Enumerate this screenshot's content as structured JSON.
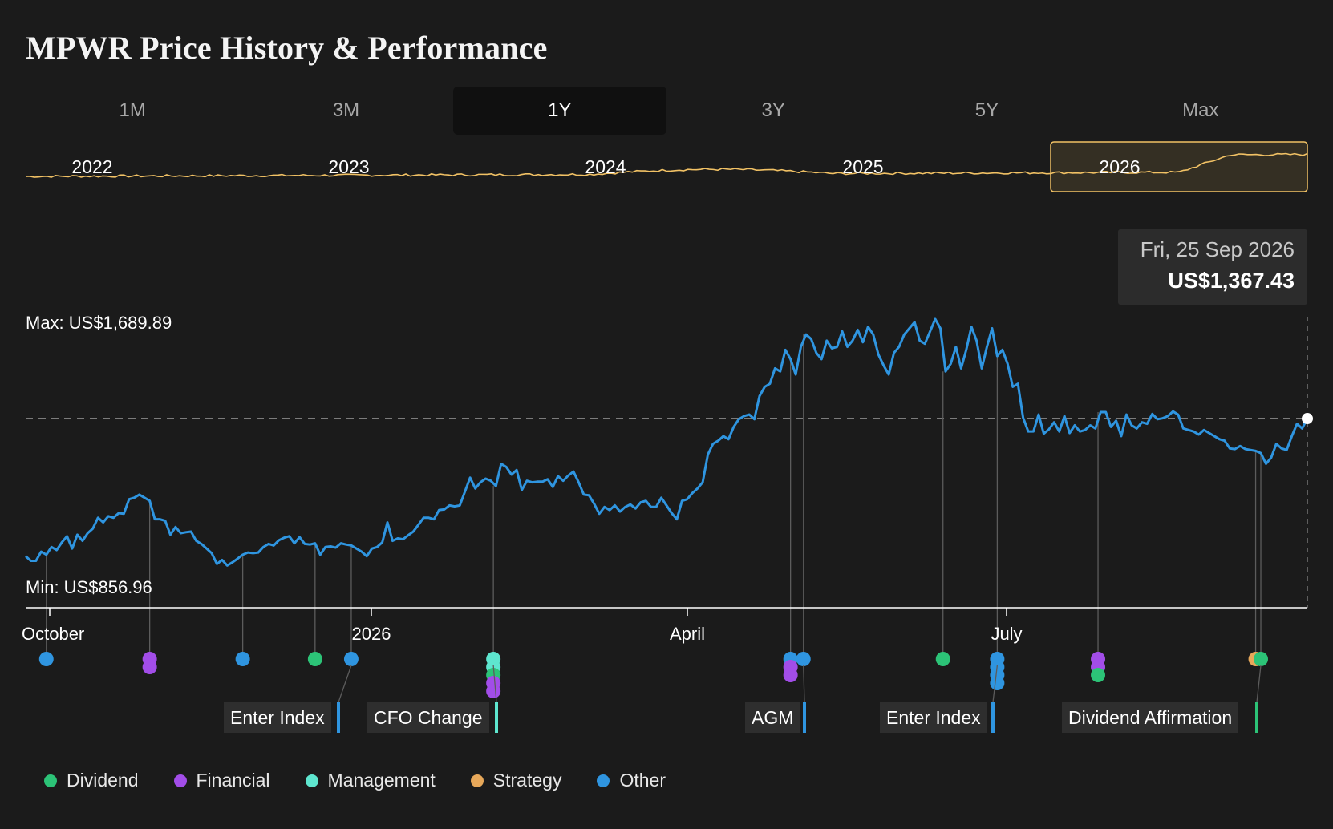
{
  "title": "MPWR Price History & Performance",
  "tabs": [
    "1M",
    "3M",
    "1Y",
    "3Y",
    "5Y",
    "Max"
  ],
  "active_tab": "1Y",
  "navigator": {
    "year_labels": [
      "2022",
      "2023",
      "2024",
      "2025",
      "2026"
    ],
    "color": "#f2c265"
  },
  "tooltip": {
    "date": "Fri, 25 Sep 2026",
    "price": "US$1,367.43"
  },
  "max_label": "Max: US$1,689.89",
  "min_label": "Min: US$856.96",
  "colors": {
    "line": "#2f95e0",
    "Dividend": "#2cc377",
    "Financial": "#a24de8",
    "Management": "#5ee6cf",
    "Strategy": "#e7a85a",
    "Other": "#2f95e0"
  },
  "legend": [
    {
      "name": "Dividend",
      "color": "#2cc377"
    },
    {
      "name": "Financial",
      "color": "#a24de8"
    },
    {
      "name": "Management",
      "color": "#5ee6cf"
    },
    {
      "name": "Strategy",
      "color": "#e7a85a"
    },
    {
      "name": "Other",
      "color": "#2f95e0"
    }
  ],
  "event_labels": [
    {
      "text": "Enter Index",
      "color": "#2f95e0"
    },
    {
      "text": "CFO Change",
      "color": "#5ee6cf"
    },
    {
      "text": "AGM",
      "color": "#2f95e0"
    },
    {
      "text": "Enter Index",
      "color": "#2f95e0"
    },
    {
      "text": "Dividend Affirmation",
      "color": "#2cc377"
    }
  ],
  "chart_data": {
    "type": "line",
    "title": "MPWR Price History & Performance",
    "x_tick_labels": [
      "October",
      "2026",
      "April",
      "July"
    ],
    "x_range": [
      "2025-09-25",
      "2026-09-25"
    ],
    "y_range": [
      856.96,
      1689.89
    ],
    "reference_value": 1367.43,
    "series": [
      {
        "values": [
          [
            0,
            920
          ],
          [
            2,
            905
          ],
          [
            4,
            905
          ],
          [
            6,
            935
          ],
          [
            8,
            925
          ],
          [
            10,
            950
          ],
          [
            12,
            940
          ],
          [
            14,
            965
          ],
          [
            16,
            985
          ],
          [
            18,
            945
          ],
          [
            20,
            990
          ],
          [
            22,
            970
          ],
          [
            24,
            995
          ],
          [
            26,
            1010
          ],
          [
            28,
            1045
          ],
          [
            30,
            1030
          ],
          [
            32,
            1050
          ],
          [
            34,
            1045
          ],
          [
            36,
            1060
          ],
          [
            38,
            1058
          ],
          [
            40,
            1105
          ],
          [
            42,
            1110
          ],
          [
            44,
            1120
          ],
          [
            46,
            1110
          ],
          [
            48,
            1100
          ],
          [
            50,
            1040
          ],
          [
            52,
            1040
          ],
          [
            54,
            1035
          ],
          [
            56,
            990
          ],
          [
            58,
            1015
          ],
          [
            60,
            995
          ],
          [
            62,
            998
          ],
          [
            64,
            1000
          ],
          [
            66,
            970
          ],
          [
            68,
            960
          ],
          [
            70,
            945
          ],
          [
            72,
            930
          ],
          [
            74,
            895
          ],
          [
            76,
            908
          ],
          [
            78,
            890
          ],
          [
            80,
            900
          ],
          [
            82,
            912
          ],
          [
            84,
            925
          ],
          [
            86,
            932
          ],
          [
            88,
            930
          ],
          [
            90,
            932
          ],
          [
            92,
            950
          ],
          [
            94,
            960
          ],
          [
            96,
            955
          ],
          [
            98,
            972
          ],
          [
            100,
            980
          ],
          [
            102,
            985
          ],
          [
            104,
            962
          ],
          [
            106,
            982
          ],
          [
            108,
            960
          ],
          [
            110,
            958
          ],
          [
            112,
            962
          ],
          [
            114,
            925
          ],
          [
            116,
            950
          ],
          [
            118,
            952
          ],
          [
            120,
            948
          ],
          [
            122,
            962
          ],
          [
            124,
            958
          ],
          [
            126,
            955
          ],
          [
            128,
            945
          ],
          [
            130,
            935
          ],
          [
            132,
            920
          ],
          [
            134,
            945
          ],
          [
            136,
            950
          ],
          [
            138,
            965
          ],
          [
            140,
            1030
          ],
          [
            142,
            970
          ],
          [
            144,
            978
          ],
          [
            146,
            975
          ],
          [
            148,
            988
          ],
          [
            150,
            1000
          ],
          [
            152,
            1022
          ],
          [
            154,
            1045
          ],
          [
            156,
            1045
          ],
          [
            158,
            1040
          ],
          [
            160,
            1070
          ],
          [
            162,
            1072
          ],
          [
            164,
            1085
          ],
          [
            166,
            1082
          ],
          [
            168,
            1085
          ],
          [
            170,
            1130
          ],
          [
            172,
            1175
          ],
          [
            174,
            1140
          ],
          [
            176,
            1160
          ],
          [
            178,
            1172
          ],
          [
            180,
            1165
          ],
          [
            182,
            1148
          ],
          [
            184,
            1220
          ],
          [
            186,
            1210
          ],
          [
            188,
            1185
          ],
          [
            190,
            1200
          ],
          [
            192,
            1135
          ],
          [
            194,
            1165
          ],
          [
            196,
            1160
          ],
          [
            198,
            1162
          ],
          [
            200,
            1162
          ],
          [
            202,
            1170
          ],
          [
            204,
            1145
          ],
          [
            206,
            1180
          ],
          [
            208,
            1165
          ],
          [
            210,
            1182
          ],
          [
            212,
            1195
          ],
          [
            214,
            1160
          ],
          [
            216,
            1120
          ],
          [
            218,
            1118
          ],
          [
            220,
            1090
          ],
          [
            222,
            1058
          ],
          [
            224,
            1080
          ],
          [
            226,
            1070
          ],
          [
            228,
            1085
          ],
          [
            230,
            1065
          ],
          [
            232,
            1080
          ],
          [
            234,
            1088
          ],
          [
            236,
            1075
          ],
          [
            238,
            1095
          ],
          [
            240,
            1100
          ],
          [
            242,
            1080
          ],
          [
            244,
            1080
          ],
          [
            246,
            1110
          ],
          [
            248,
            1085
          ],
          [
            250,
            1060
          ],
          [
            252,
            1040
          ],
          [
            254,
            1100
          ],
          [
            256,
            1105
          ],
          [
            258,
            1125
          ],
          [
            260,
            1140
          ],
          [
            262,
            1160
          ],
          [
            264,
            1250
          ],
          [
            266,
            1285
          ],
          [
            268,
            1295
          ],
          [
            270,
            1310
          ],
          [
            272,
            1300
          ],
          [
            274,
            1340
          ],
          [
            276,
            1365
          ],
          [
            278,
            1375
          ],
          [
            280,
            1380
          ],
          [
            282,
            1365
          ],
          [
            284,
            1440
          ],
          [
            286,
            1470
          ],
          [
            288,
            1480
          ],
          [
            290,
            1530
          ],
          [
            292,
            1520
          ],
          [
            294,
            1590
          ],
          [
            296,
            1560
          ],
          [
            298,
            1510
          ],
          [
            300,
            1600
          ],
          [
            302,
            1640
          ],
          [
            304,
            1625
          ],
          [
            306,
            1580
          ],
          [
            308,
            1560
          ],
          [
            310,
            1620
          ],
          [
            312,
            1595
          ],
          [
            314,
            1600
          ],
          [
            316,
            1650
          ],
          [
            318,
            1600
          ],
          [
            320,
            1620
          ],
          [
            322,
            1655
          ],
          [
            324,
            1615
          ],
          [
            326,
            1665
          ],
          [
            328,
            1640
          ],
          [
            330,
            1575
          ],
          [
            332,
            1540
          ],
          [
            334,
            1510
          ],
          [
            336,
            1580
          ],
          [
            338,
            1600
          ],
          [
            340,
            1640
          ],
          [
            342,
            1660
          ],
          [
            344,
            1680
          ],
          [
            346,
            1620
          ],
          [
            348,
            1610
          ],
          [
            350,
            1650
          ],
          [
            352,
            1690
          ],
          [
            354,
            1660
          ],
          [
            356,
            1520
          ],
          [
            358,
            1545
          ],
          [
            360,
            1600
          ],
          [
            362,
            1530
          ],
          [
            364,
            1590
          ],
          [
            366,
            1665
          ],
          [
            368,
            1620
          ],
          [
            370,
            1530
          ],
          [
            372,
            1600
          ],
          [
            374,
            1660
          ],
          [
            376,
            1570
          ],
          [
            378,
            1590
          ],
          [
            380,
            1545
          ],
          [
            382,
            1470
          ],
          [
            384,
            1480
          ],
          [
            386,
            1370
          ],
          [
            388,
            1325
          ],
          [
            390,
            1325
          ],
          [
            392,
            1380
          ],
          [
            394,
            1318
          ],
          [
            396,
            1332
          ],
          [
            398,
            1355
          ],
          [
            400,
            1325
          ],
          [
            402,
            1375
          ],
          [
            404,
            1320
          ],
          [
            406,
            1345
          ],
          [
            408,
            1325
          ],
          [
            410,
            1330
          ],
          [
            412,
            1345
          ],
          [
            414,
            1335
          ],
          [
            416,
            1388
          ],
          [
            418,
            1388
          ],
          [
            420,
            1340
          ],
          [
            422,
            1360
          ],
          [
            424,
            1310
          ],
          [
            426,
            1380
          ],
          [
            428,
            1345
          ],
          [
            430,
            1335
          ],
          [
            432,
            1355
          ],
          [
            434,
            1350
          ],
          [
            436,
            1382
          ],
          [
            438,
            1365
          ],
          [
            440,
            1368
          ],
          [
            442,
            1375
          ],
          [
            444,
            1390
          ],
          [
            446,
            1380
          ],
          [
            448,
            1335
          ],
          [
            450,
            1330
          ],
          [
            452,
            1325
          ],
          [
            454,
            1315
          ],
          [
            456,
            1330
          ],
          [
            458,
            1320
          ],
          [
            460,
            1310
          ],
          [
            462,
            1300
          ],
          [
            464,
            1295
          ],
          [
            466,
            1270
          ],
          [
            468,
            1268
          ],
          [
            470,
            1278
          ],
          [
            472,
            1268
          ],
          [
            474,
            1265
          ],
          [
            476,
            1262
          ],
          [
            478,
            1255
          ],
          [
            480,
            1220
          ],
          [
            482,
            1240
          ],
          [
            484,
            1285
          ],
          [
            486,
            1270
          ],
          [
            488,
            1265
          ],
          [
            490,
            1310
          ],
          [
            492,
            1350
          ],
          [
            494,
            1335
          ],
          [
            496,
            1367
          ]
        ]
      }
    ],
    "events": [
      {
        "x": 8,
        "color": "Other",
        "count": 1
      },
      {
        "x": 48,
        "color": "Financial",
        "count": 2
      },
      {
        "x": 84,
        "color": "Other",
        "count": 1
      },
      {
        "x": 112,
        "color": "Dividend",
        "count": 1
      },
      {
        "x": 126,
        "color": "Other",
        "count": 1
      },
      {
        "x": 181,
        "color": "Management",
        "count": 5
      },
      {
        "x": 296,
        "color": "Other",
        "count": 3
      },
      {
        "x": 301,
        "color": "Other",
        "count": 1
      },
      {
        "x": 355,
        "color": "Dividend",
        "count": 1
      },
      {
        "x": 376,
        "color": "Other",
        "count": 4
      },
      {
        "x": 415,
        "color": "Financial",
        "count": 3
      },
      {
        "x": 476,
        "color": "Strategy",
        "count": 1
      },
      {
        "x": 478,
        "color": "Dividend",
        "count": 1
      }
    ]
  }
}
